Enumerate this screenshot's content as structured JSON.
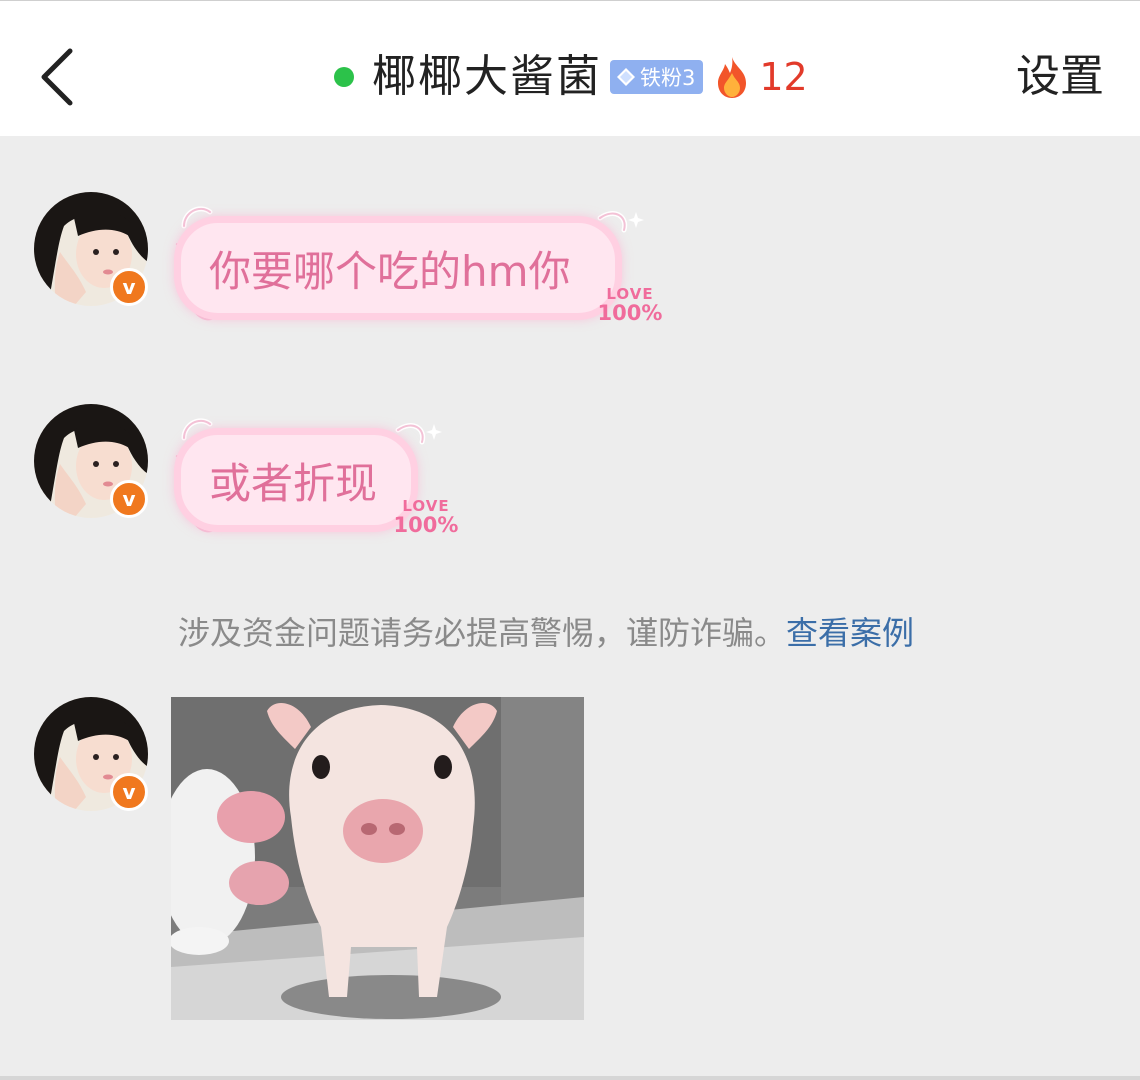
{
  "header": {
    "contact_name": "椰椰大酱菌",
    "fan_badge_label": "铁粉3",
    "streak_count": "12",
    "settings_label": "设置",
    "online_color": "#2cc24a"
  },
  "messages": [
    {
      "type": "text",
      "text": "你要哪个吃的hm你",
      "sticker_love": "LOVE",
      "sticker_pct": "100%"
    },
    {
      "type": "text",
      "text": "或者折现",
      "sticker_love": "LOVE",
      "sticker_pct": "100%"
    },
    {
      "type": "image",
      "subject": "piglet"
    }
  ],
  "system_notice": {
    "text": "涉及资金问题请务必提高警惕，谨防诈骗。",
    "link": "查看案例"
  },
  "avatar_badge": "v"
}
